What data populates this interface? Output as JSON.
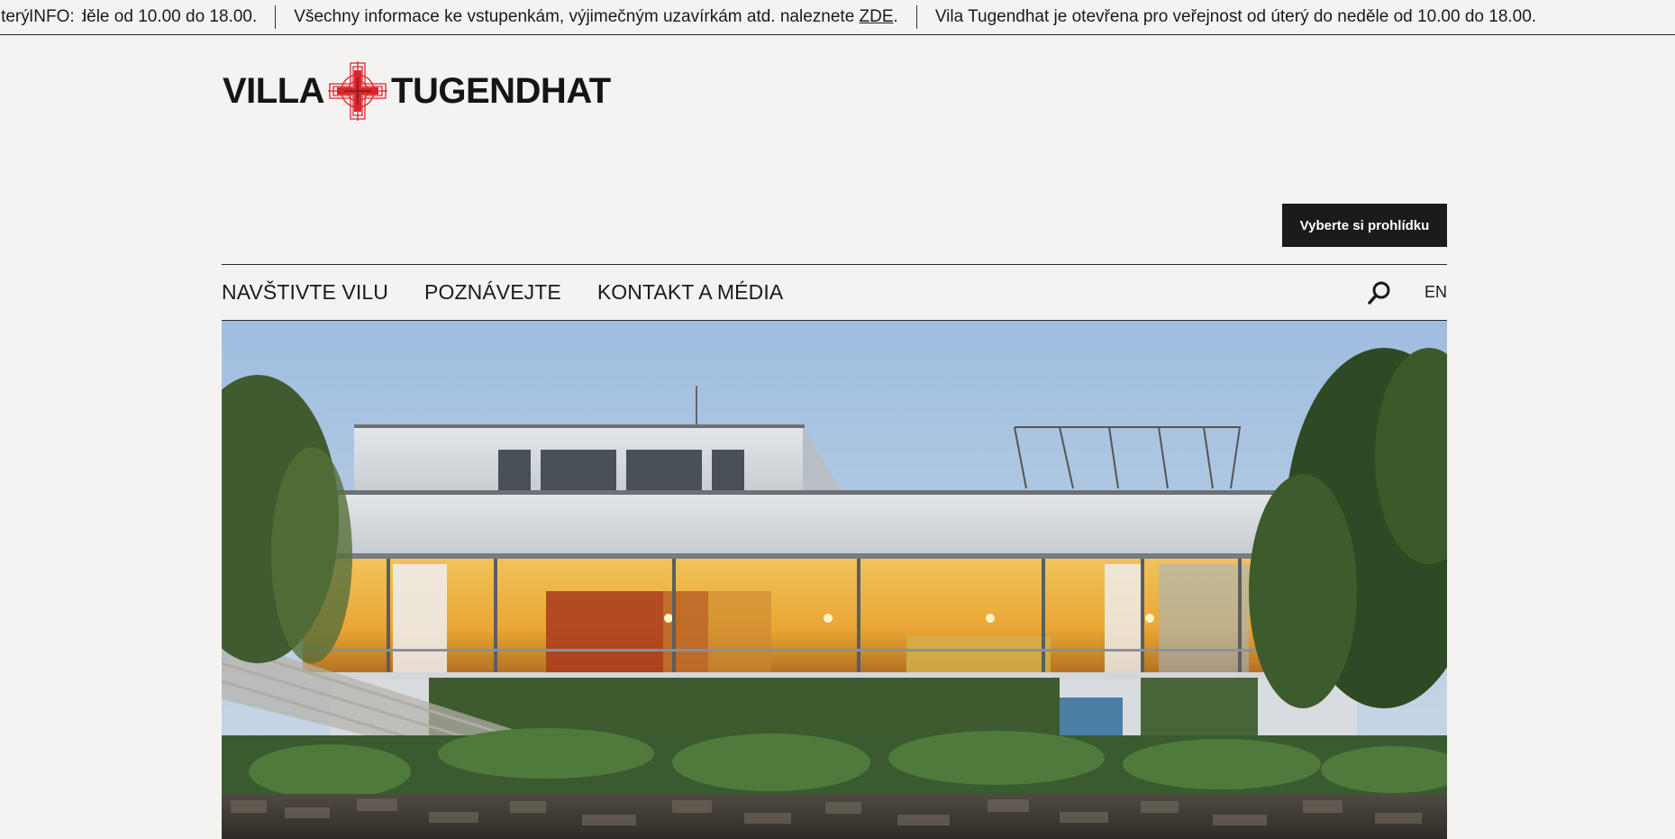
{
  "info_bar": {
    "label": "INFO:",
    "items": [
      {
        "text": "Vila Tugendhat je otevřena pro veřejnost od úterý do neděle od 10.00 do 18.00.",
        "link": ""
      },
      {
        "text": "Všechny informace ke vstupenkám, výjimečným uzavírkám atd. naleznete ",
        "link": "ZDE",
        "suffix": "."
      },
      {
        "text": "Vila Tugendhat je otevřena pro veřejnost od úterý do neděle od 10.00 do 18.00.",
        "link": ""
      }
    ]
  },
  "logo": {
    "left_word": "VILLA",
    "right_word": "TUGENDHAT",
    "mark_icon": "red-cross-emblem-icon"
  },
  "cta": {
    "label": "Vyberte si prohlídku"
  },
  "nav": {
    "items": [
      "NAVŠTIVTE VILU",
      "POZNÁVEJTE",
      "KONTAKT A MÉDIA"
    ],
    "search_icon": "search-icon",
    "language": "EN"
  },
  "hero": {
    "image": "villa-tugendhat-exterior-photo"
  },
  "colors": {
    "background": "#f4f3f1",
    "text": "#1a1a1a",
    "button_bg": "#1b1b1b",
    "logo_red": "#d9262b"
  }
}
